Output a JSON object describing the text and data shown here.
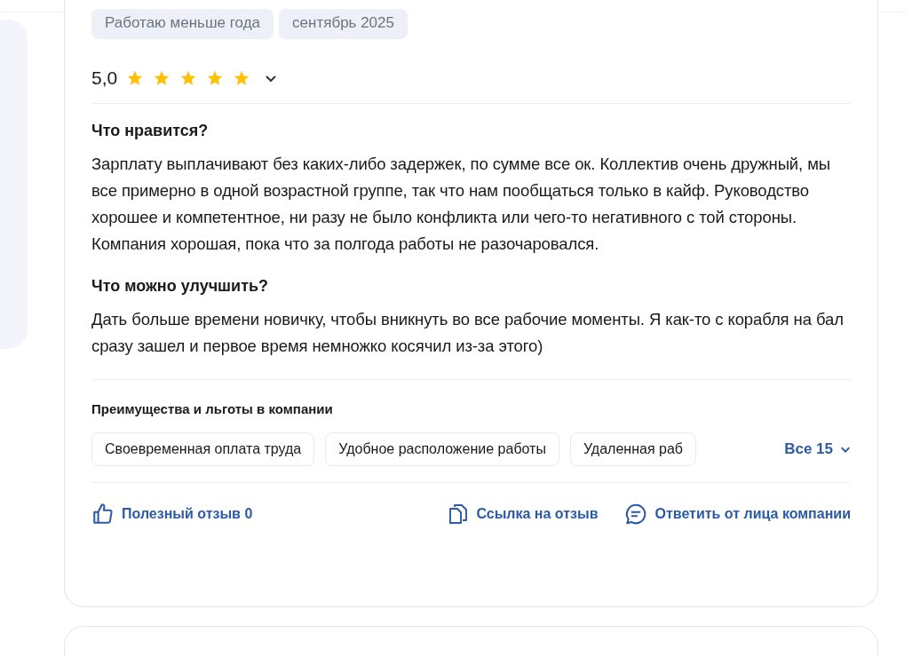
{
  "tags": [
    "Работаю меньше года",
    "сентябрь 2025"
  ],
  "rating": {
    "value": "5,0",
    "stars": 5,
    "expanded": false
  },
  "sections": [
    {
      "title": "Что нравится?",
      "text": "Зарплату выплачивают без каких-либо задержек, по сумме все ок. Коллектив очень дружный, мы все примерно в одной возрастной группе, так что нам пообщаться только в кайф. Руководство хорошее и компетентное, ни разу не было конфликта или чего-то негативного с той стороны. Компания хорошая, пока что за полгода работы не разочаровался."
    },
    {
      "title": "Что можно улучшить?",
      "text": "Дать больше времени новичку, чтобы вникнуть во все рабочие моменты. Я как-то с корабля на бал сразу зашел и первое время немножко косячил из-за этого)"
    }
  ],
  "benefits": {
    "title": "Преимущества и льготы в компании",
    "items": [
      "Своевременная оплата труда",
      "Удобное расположение работы",
      "Удаленная раб"
    ],
    "more": "Все 15"
  },
  "actions": [
    {
      "kind": "like",
      "label": "Полезный отзыв 0"
    },
    {
      "kind": "link",
      "label": "Ссылка на отзыв"
    },
    {
      "kind": "reply",
      "label": "Ответить от лица компании"
    }
  ]
}
